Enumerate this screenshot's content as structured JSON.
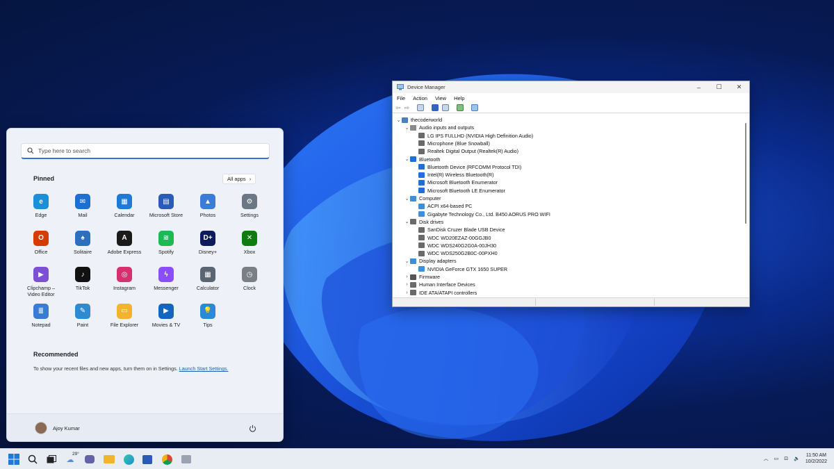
{
  "start_menu": {
    "search_placeholder": "Type here to search",
    "pinned_label": "Pinned",
    "all_apps_label": "All apps",
    "apps": [
      {
        "name": "Edge",
        "color": "#1b8fd8",
        "glyph": "e"
      },
      {
        "name": "Mail",
        "color": "#1d6fd1",
        "glyph": "✉"
      },
      {
        "name": "Calendar",
        "color": "#1e7ad6",
        "glyph": "▦"
      },
      {
        "name": "Microsoft Store",
        "color": "#2a5bb8",
        "glyph": "▤"
      },
      {
        "name": "Photos",
        "color": "#3d7bd9",
        "glyph": "▲"
      },
      {
        "name": "Settings",
        "color": "#6b7785",
        "glyph": "⚙"
      },
      {
        "name": "Office",
        "color": "#d83b01",
        "glyph": "O"
      },
      {
        "name": "Solitaire",
        "color": "#2c6fbf",
        "glyph": "♠"
      },
      {
        "name": "Adobe Express",
        "color": "#1a1a1a",
        "glyph": "A"
      },
      {
        "name": "Spotify",
        "color": "#1db954",
        "glyph": "≋"
      },
      {
        "name": "Disney+",
        "color": "#0d1a5c",
        "glyph": "D+"
      },
      {
        "name": "Xbox",
        "color": "#107c10",
        "glyph": "✕"
      },
      {
        "name": "Clipchamp – Video Editor",
        "color": "#7b4fd6",
        "glyph": "▶"
      },
      {
        "name": "TikTok",
        "color": "#111111",
        "glyph": "♪"
      },
      {
        "name": "Instagram",
        "color": "#d6306f",
        "glyph": "◎"
      },
      {
        "name": "Messenger",
        "color": "#8a4dff",
        "glyph": "ϟ"
      },
      {
        "name": "Calculator",
        "color": "#5b6572",
        "glyph": "▦"
      },
      {
        "name": "Clock",
        "color": "#7a7f87",
        "glyph": "◷"
      },
      {
        "name": "Notepad",
        "color": "#3a7bd5",
        "glyph": "≣"
      },
      {
        "name": "Paint",
        "color": "#2e8bd0",
        "glyph": "✎"
      },
      {
        "name": "File Explorer",
        "color": "#f2b42c",
        "glyph": "▭"
      },
      {
        "name": "Movies & TV",
        "color": "#1565c0",
        "glyph": "▶"
      },
      {
        "name": "Tips",
        "color": "#2b8ad6",
        "glyph": "💡"
      }
    ],
    "recommended_label": "Recommended",
    "recommended_text": "To show your recent files and new apps, turn them on in Settings. ",
    "recommended_link": "Launch Start Settings.",
    "user_name": "Ajoy Kumar"
  },
  "device_manager": {
    "title": "Device Manager",
    "menu": [
      "File",
      "Action",
      "View",
      "Help"
    ],
    "tree": [
      {
        "level": 0,
        "chev": "⌄",
        "label": "thecoderworld",
        "color": "#4a7fc1"
      },
      {
        "level": 1,
        "chev": "⌄",
        "label": "Audio inputs and outputs",
        "color": "#8a8a8a"
      },
      {
        "level": 2,
        "chev": "",
        "label": "LG IPS FULLHD (NVIDIA High Definition Audio)",
        "color": "#6a6a6a"
      },
      {
        "level": 2,
        "chev": "",
        "label": "Microphone (Blue Snowball)",
        "color": "#6a6a6a"
      },
      {
        "level": 2,
        "chev": "",
        "label": "Realtek Digital Output (Realtek(R) Audio)",
        "color": "#6a6a6a"
      },
      {
        "level": 1,
        "chev": "⌄",
        "label": "Bluetooth",
        "color": "#1e6fd9"
      },
      {
        "level": 2,
        "chev": "",
        "label": "Bluetooth Device (RFCOMM Protocol TDI)",
        "color": "#1e6fd9"
      },
      {
        "level": 2,
        "chev": "",
        "label": "Intel(R) Wireless Bluetooth(R)",
        "color": "#1e6fd9"
      },
      {
        "level": 2,
        "chev": "",
        "label": "Microsoft Bluetooth Enumerator",
        "color": "#1e6fd9"
      },
      {
        "level": 2,
        "chev": "",
        "label": "Microsoft Bluetooth LE Enumerator",
        "color": "#1e6fd9"
      },
      {
        "level": 1,
        "chev": "⌄",
        "label": "Computer",
        "color": "#3c8fd8"
      },
      {
        "level": 2,
        "chev": "",
        "label": "ACPI x64-based PC",
        "color": "#3c8fd8"
      },
      {
        "level": 2,
        "chev": "",
        "label": "Gigabyte Technology Co., Ltd. B450 AORUS PRO WIFI",
        "color": "#3c8fd8"
      },
      {
        "level": 1,
        "chev": "⌄",
        "label": "Disk drives",
        "color": "#6a6a6a"
      },
      {
        "level": 2,
        "chev": "",
        "label": "SanDisk Cruzer Blade USB Device",
        "color": "#6a6a6a"
      },
      {
        "level": 2,
        "chev": "",
        "label": "WDC WD20EZAZ-00GGJB0",
        "color": "#6a6a6a"
      },
      {
        "level": 2,
        "chev": "",
        "label": "WDC WDS240G2G0A-00JH30",
        "color": "#6a6a6a"
      },
      {
        "level": 2,
        "chev": "",
        "label": "WDC WDS250G2B0C-00PXH0",
        "color": "#6a6a6a"
      },
      {
        "level": 1,
        "chev": "⌄",
        "label": "Display adapters",
        "color": "#3c8fd8"
      },
      {
        "level": 2,
        "chev": "",
        "label": "NVIDIA GeForce GTX 1650 SUPER",
        "color": "#3c8fd8"
      },
      {
        "level": 1,
        "chev": "›",
        "label": "Firmware",
        "color": "#555555"
      },
      {
        "level": 1,
        "chev": "›",
        "label": "Human Interface Devices",
        "color": "#6a6a6a"
      },
      {
        "level": 1,
        "chev": "›",
        "label": "IDE ATA/ATAPI controllers",
        "color": "#6a6a6a"
      }
    ]
  },
  "taskbar": {
    "weather_temp": "29°",
    "time": "11:50 AM",
    "date": "10/2/2022"
  }
}
